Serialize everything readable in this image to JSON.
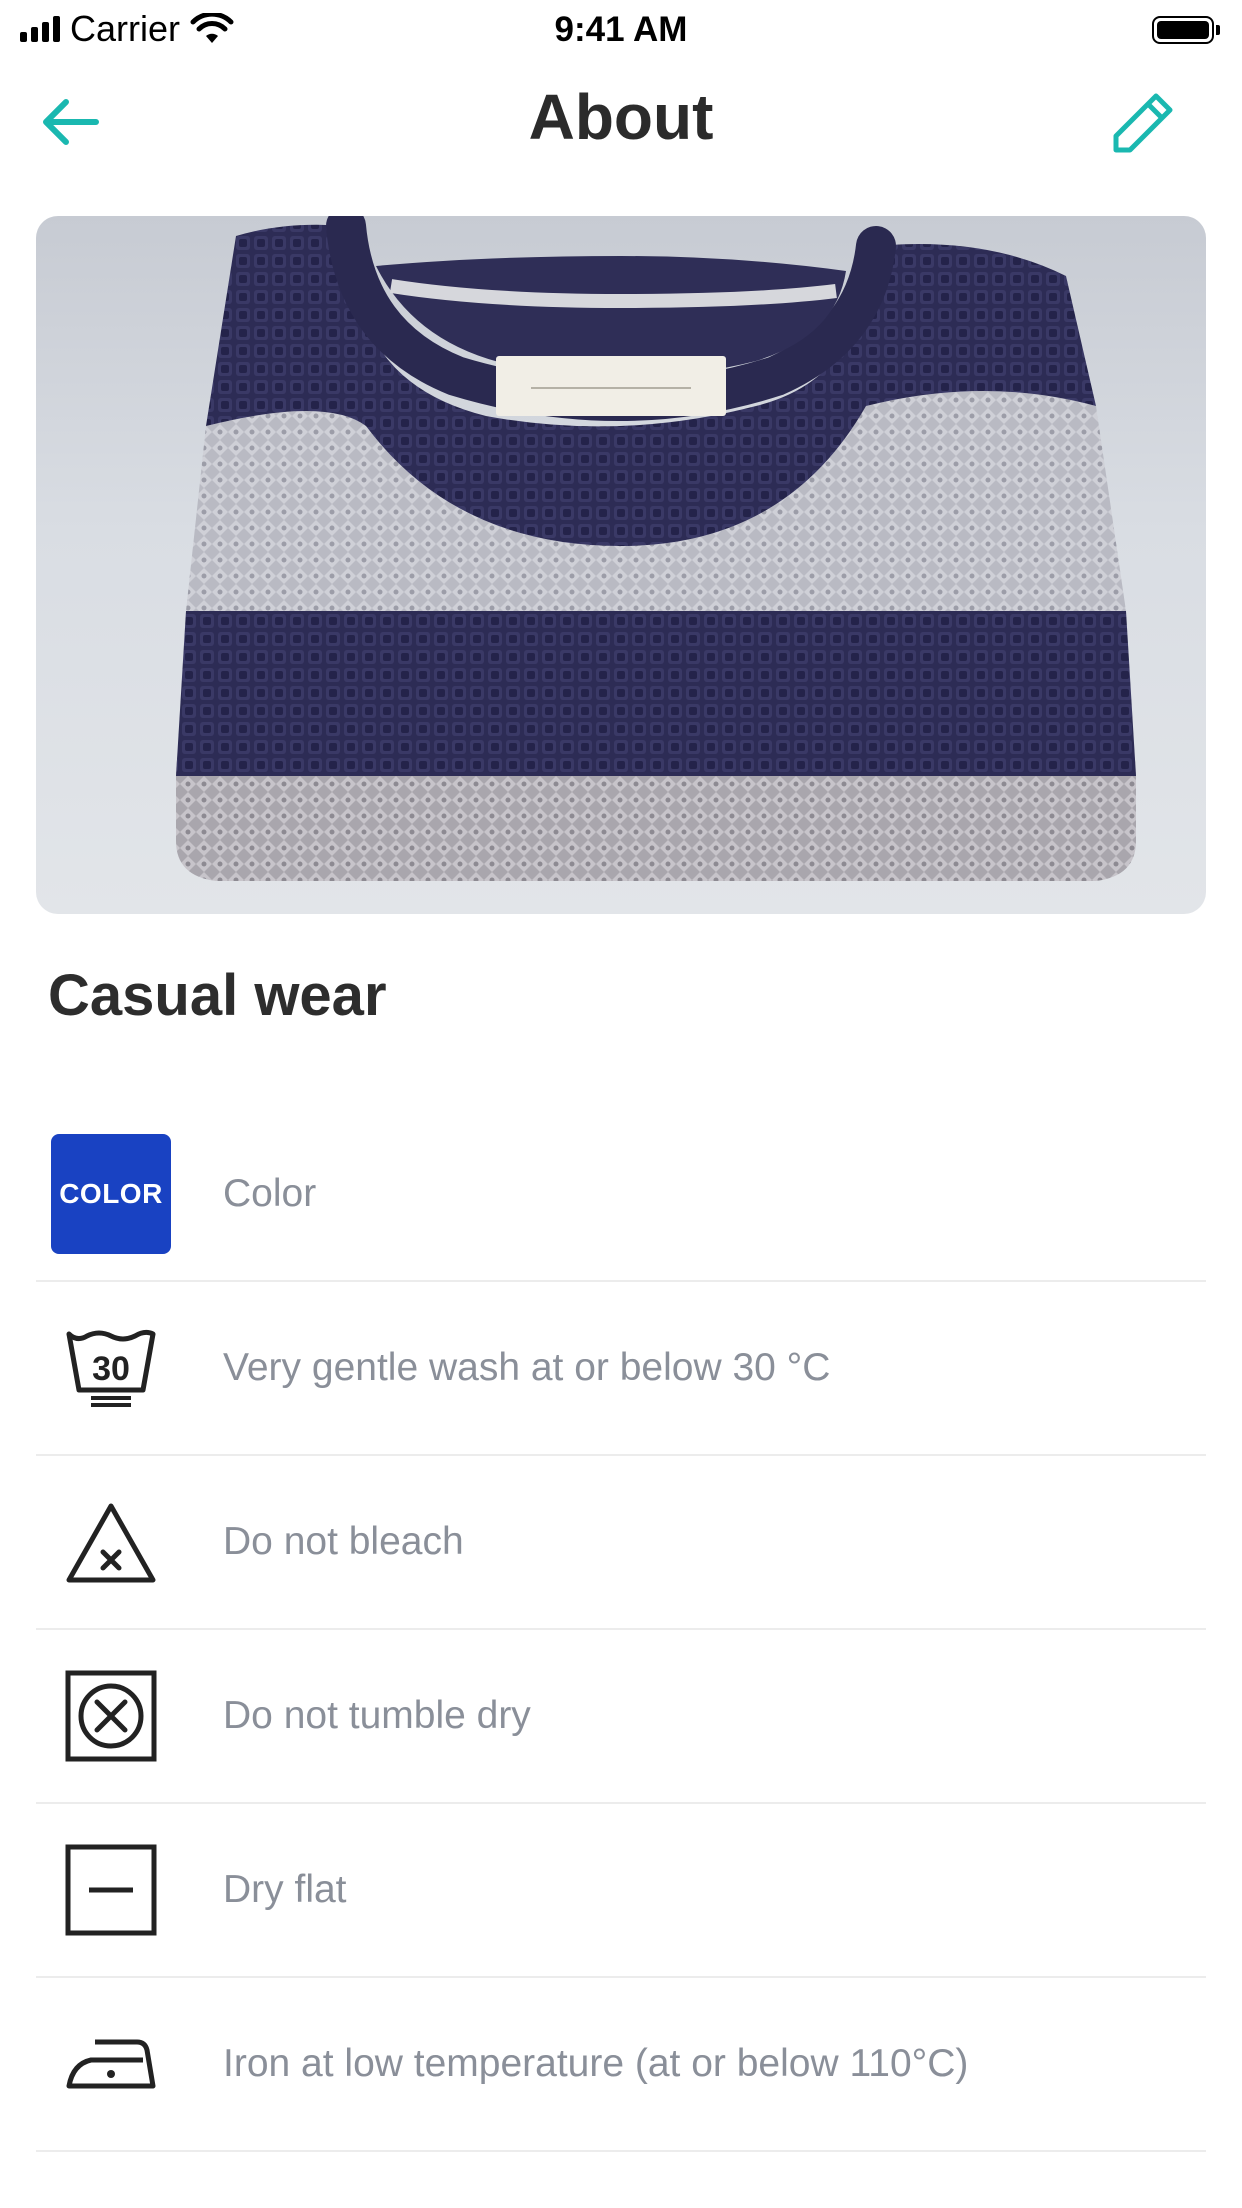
{
  "status_bar": {
    "carrier": "Carrier",
    "time": "9:41 AM"
  },
  "nav": {
    "title": "About",
    "back_icon": "arrow-left-icon",
    "edit_icon": "pencil-icon",
    "accent_color": "#1ab8b0"
  },
  "hero": {
    "subject": "folded striped knit sweater"
  },
  "item": {
    "title": "Casual wear"
  },
  "care": {
    "color_badge_text": "COLOR",
    "color_badge_color": "#1942c2",
    "wash_number": "30",
    "rows": [
      {
        "icon": "color-badge-icon",
        "label": "Color"
      },
      {
        "icon": "wash-30-icon",
        "label": "Very gentle wash at or below 30 °C"
      },
      {
        "icon": "do-not-bleach-icon",
        "label": "Do not bleach"
      },
      {
        "icon": "do-not-tumble-dry-icon",
        "label": "Do not tumble dry"
      },
      {
        "icon": "dry-flat-icon",
        "label": "Dry flat"
      },
      {
        "icon": "iron-low-icon",
        "label": "Iron at low temperature (at or below 110°C)"
      }
    ]
  }
}
